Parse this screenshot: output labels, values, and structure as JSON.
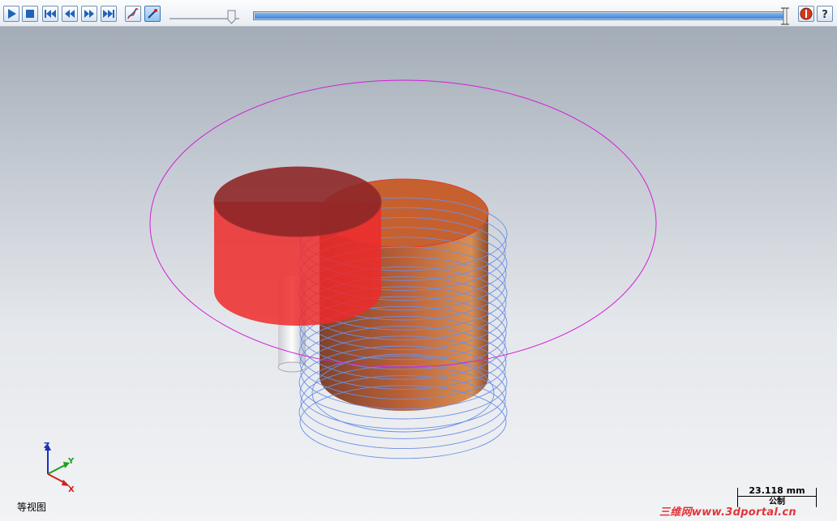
{
  "toolbar": {
    "buttons": [
      "play-icon",
      "stop-icon",
      "go-to-start-icon",
      "step-back-icon",
      "step-forward-icon",
      "go-to-end-icon",
      "toolpath-display-icon",
      "tool-display-icon"
    ],
    "speed_level": 0.87,
    "progress_level": 1.0,
    "right_buttons": [
      "stop-simulation-icon",
      "help-icon"
    ]
  },
  "view": {
    "name": "等视图",
    "axes": {
      "z": "Z",
      "y": "Y",
      "x": "X"
    }
  },
  "scale": {
    "value": "23.118 mm",
    "unit": "公制"
  },
  "watermark": "三维网www.3dportal.cn",
  "colors": {
    "stock": "#e33a38",
    "part": "#c6612f",
    "toolpath": "#6b8fe6",
    "boundary": "#d21fd8",
    "axis_x": "#d02020",
    "axis_y": "#1aa01a",
    "axis_z": "#1a2fbf"
  }
}
